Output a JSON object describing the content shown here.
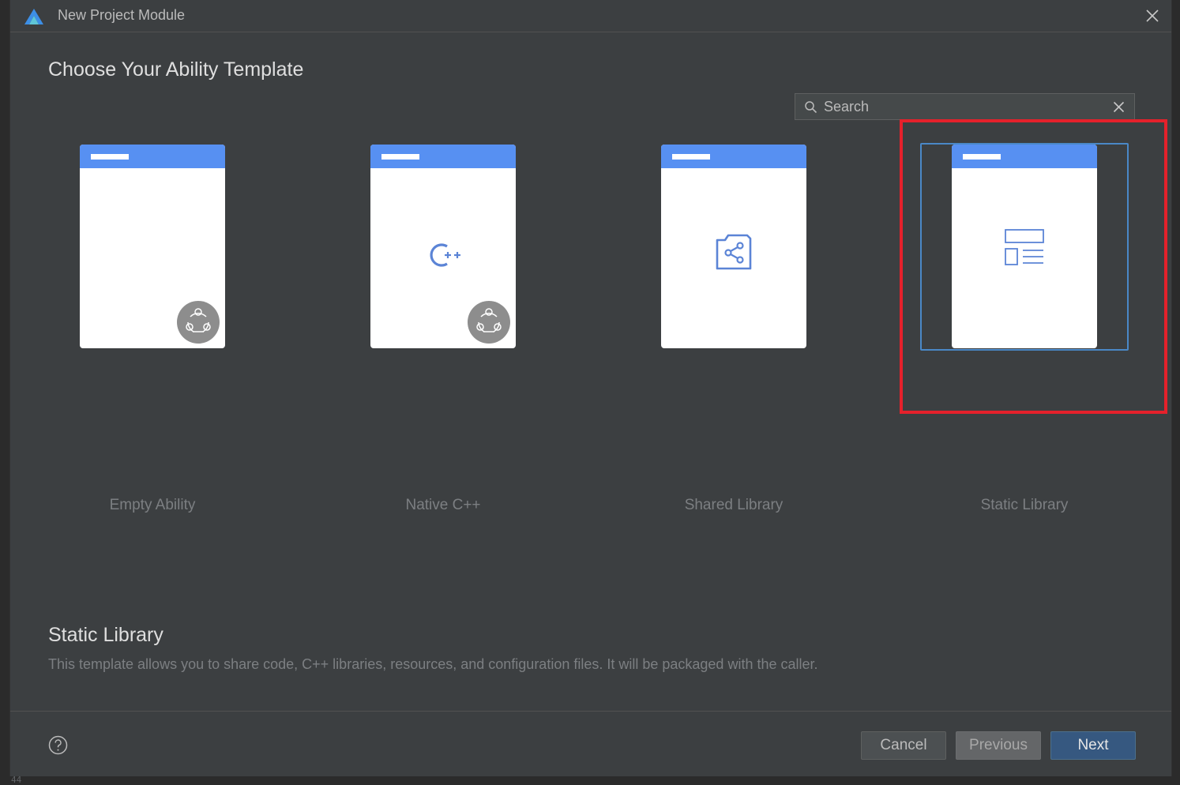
{
  "window": {
    "title": "New Project Module"
  },
  "heading": "Choose Your Ability Template",
  "search": {
    "placeholder": "Search",
    "value": ""
  },
  "templates": [
    {
      "label": "Empty Ability",
      "icon": "atomic-badge-icon",
      "selected": false
    },
    {
      "label": "Native C++",
      "icon": "cpp-icon",
      "selected": false
    },
    {
      "label": "Shared Library",
      "icon": "shared-library-icon",
      "selected": false
    },
    {
      "label": "Static Library",
      "icon": "static-library-icon",
      "selected": true
    }
  ],
  "description": {
    "title": "Static Library",
    "text": "This template allows you to share code, C++ libraries, resources, and configuration files. It will be packaged with the caller."
  },
  "buttons": {
    "cancel": "Cancel",
    "previous": "Previous",
    "next": "Next"
  },
  "background_editor": {
    "line_number": "44"
  },
  "colors": {
    "dialog_bg": "#3c3f41",
    "card_header": "#5790f2",
    "selection_border": "#4a88c7",
    "highlight_annotation": "#e5212b",
    "primary_button": "#365880"
  }
}
